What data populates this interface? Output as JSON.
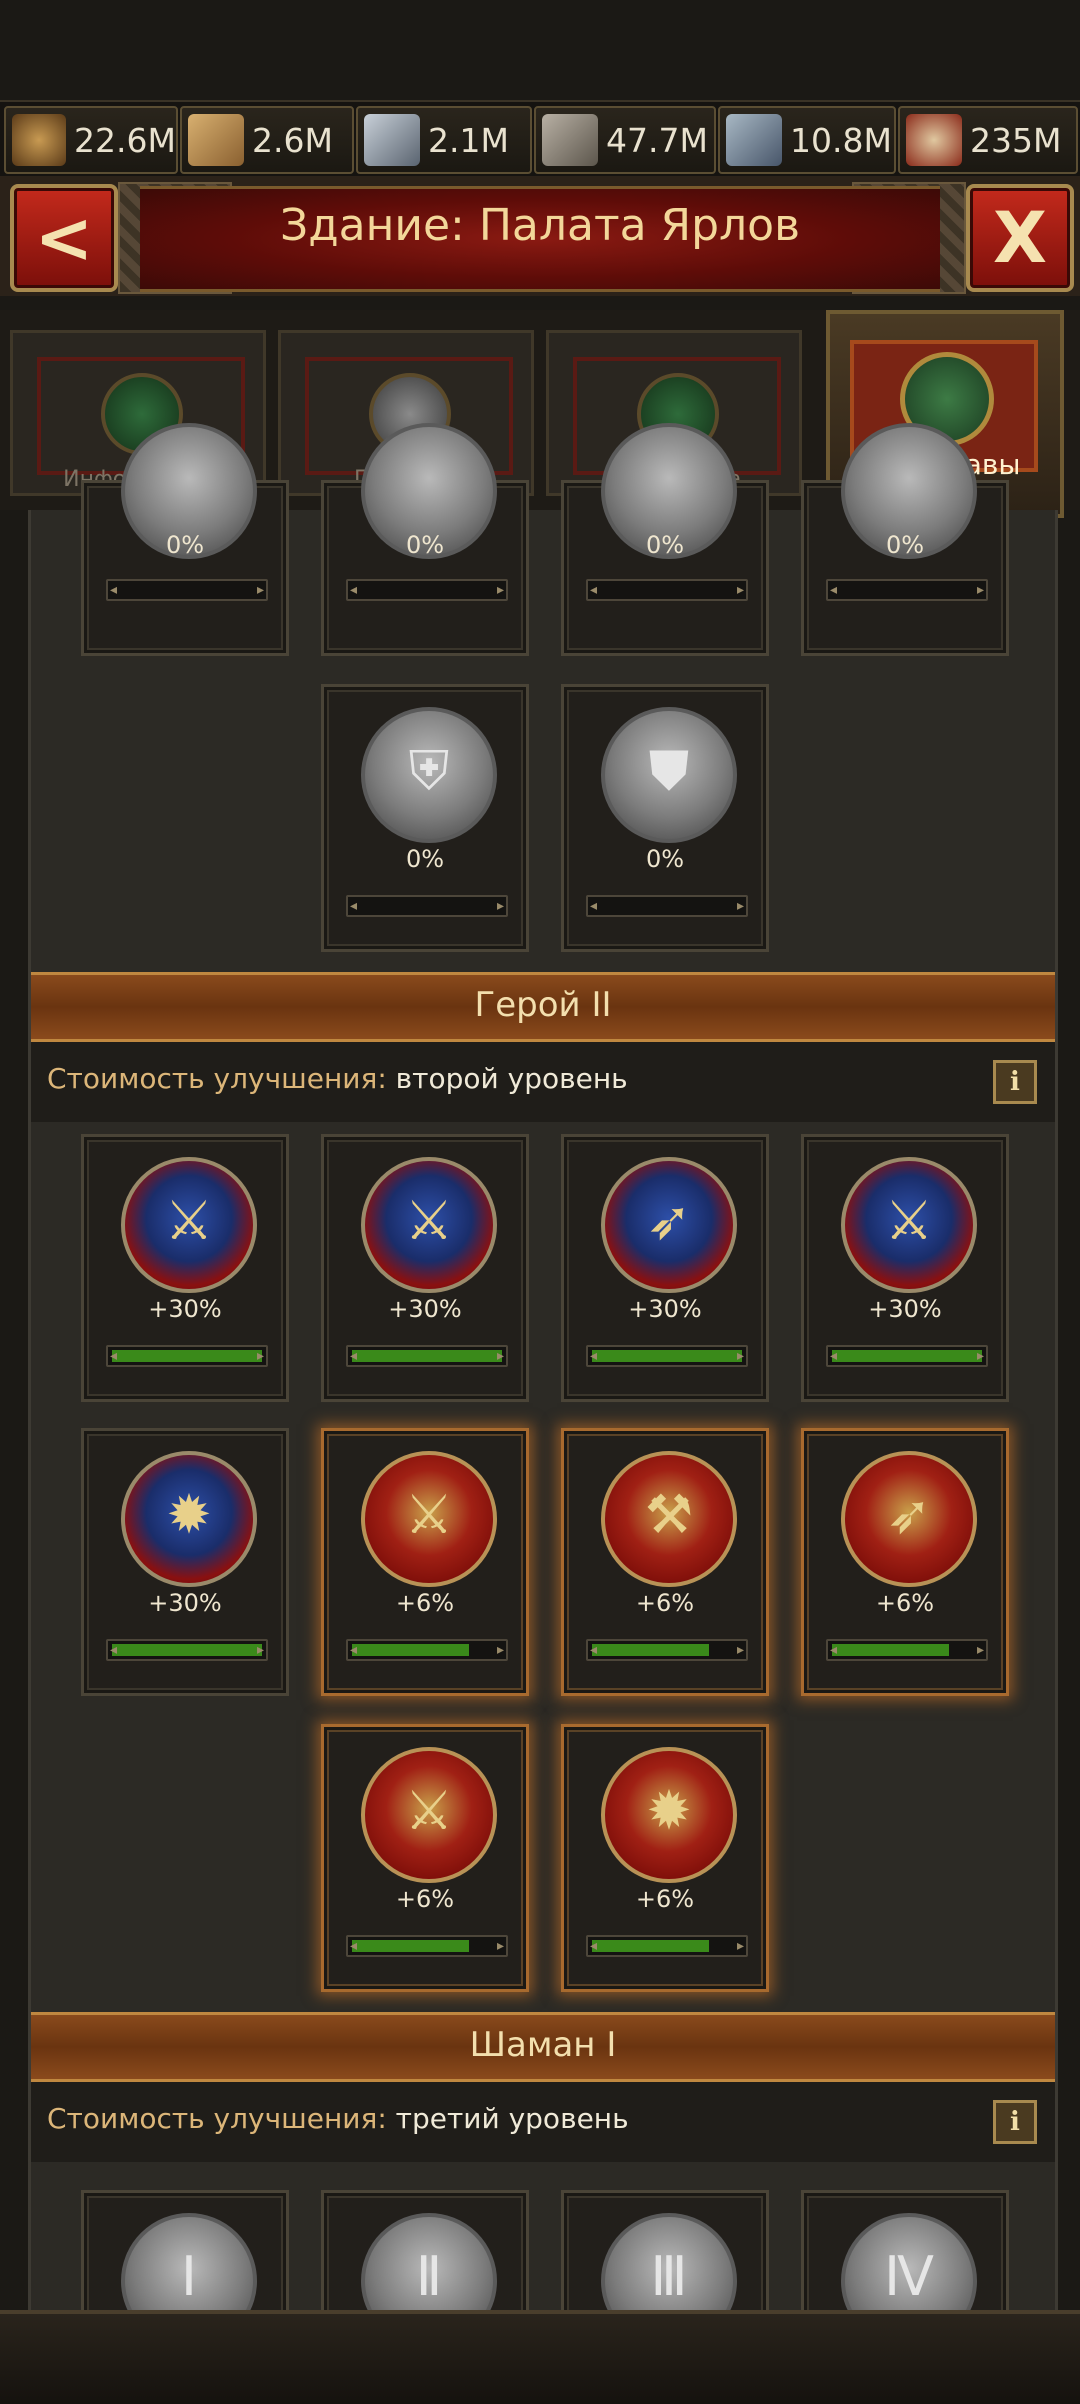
{
  "resources": [
    {
      "icon": "beer-mug-icon",
      "value": "22.6M"
    },
    {
      "icon": "wood-planks-icon",
      "value": "2.6M"
    },
    {
      "icon": "iron-ingots-icon",
      "value": "2.1M"
    },
    {
      "icon": "stone-blocks-icon",
      "value": "47.7M"
    },
    {
      "icon": "hammer-icon",
      "value": "10.8M"
    },
    {
      "icon": "treasure-chest-icon",
      "value": "235M"
    }
  ],
  "header": {
    "title": "Здание: Палата Ярлов",
    "back_label": "<",
    "close_label": "X"
  },
  "tabs": [
    {
      "label": "Информация",
      "active": false
    },
    {
      "label": "Профиль",
      "active": false
    },
    {
      "label": "Статистика",
      "active": false
    },
    {
      "label": "Зал славы",
      "active": true
    }
  ],
  "top_cards": {
    "row1": [
      "0%",
      "0%",
      "0%",
      "0%"
    ],
    "row2": [
      "0%",
      "0%"
    ]
  },
  "sections": [
    {
      "title": "Герой II",
      "cost_label": "Стоимость улучшения:",
      "cost_value": "второй уровень",
      "info": "i",
      "cards": [
        {
          "value": "+30%",
          "progress": 1.0,
          "kind": "blue",
          "glyph": "⚔"
        },
        {
          "value": "+30%",
          "progress": 1.0,
          "kind": "blue",
          "glyph": "⚔"
        },
        {
          "value": "+30%",
          "progress": 1.0,
          "kind": "blue",
          "glyph": "➶"
        },
        {
          "value": "+30%",
          "progress": 1.0,
          "kind": "blue",
          "glyph": "⚔"
        },
        {
          "value": "+30%",
          "progress": 1.0,
          "kind": "blue",
          "glyph": "✹"
        },
        {
          "value": "+6%",
          "progress": 0.78,
          "kind": "red",
          "glyph": "⚔"
        },
        {
          "value": "+6%",
          "progress": 0.78,
          "kind": "red",
          "glyph": "⚒"
        },
        {
          "value": "+6%",
          "progress": 0.78,
          "kind": "red",
          "glyph": "➶"
        },
        {
          "value": "+6%",
          "progress": 0.78,
          "kind": "red",
          "glyph": "⚔"
        },
        {
          "value": "+6%",
          "progress": 0.78,
          "kind": "red",
          "glyph": "✹"
        }
      ]
    },
    {
      "title": "Шаман I",
      "cost_label": "Стоимость улучшения:",
      "cost_value": "третий уровень",
      "info": "i"
    }
  ]
}
